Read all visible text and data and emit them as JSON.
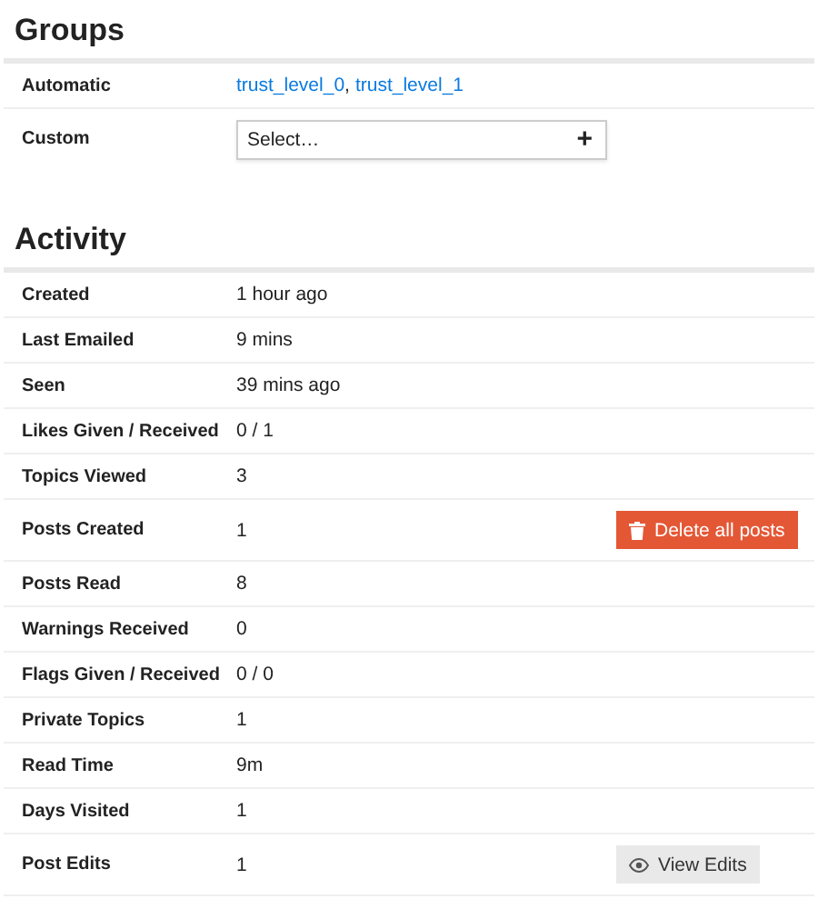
{
  "groups": {
    "title": "Groups",
    "automatic": {
      "label": "Automatic",
      "links": [
        "trust_level_0",
        "trust_level_1"
      ],
      "separator": ","
    },
    "custom": {
      "label": "Custom",
      "placeholder": "Select…",
      "add": "+"
    }
  },
  "activity": {
    "title": "Activity",
    "rows": [
      {
        "label": "Created",
        "value": "1 hour ago"
      },
      {
        "label": "Last Emailed",
        "value": "9 mins"
      },
      {
        "label": "Seen",
        "value": "39 mins ago"
      },
      {
        "label": "Likes Given / Received",
        "value": "0 / 1"
      },
      {
        "label": "Topics Viewed",
        "value": "3"
      },
      {
        "label": "Posts Created",
        "value": "1",
        "action": {
          "kind": "danger",
          "label": "Delete all posts"
        }
      },
      {
        "label": "Posts Read",
        "value": "8"
      },
      {
        "label": "Warnings Received",
        "value": "0"
      },
      {
        "label": "Flags Given / Received",
        "value": "0 / 0"
      },
      {
        "label": "Private Topics",
        "value": "1"
      },
      {
        "label": "Read Time",
        "value": "9m"
      },
      {
        "label": "Days Visited",
        "value": "1"
      },
      {
        "label": "Post Edits",
        "value": "1",
        "action": {
          "kind": "default",
          "label": "View Edits"
        }
      }
    ]
  }
}
